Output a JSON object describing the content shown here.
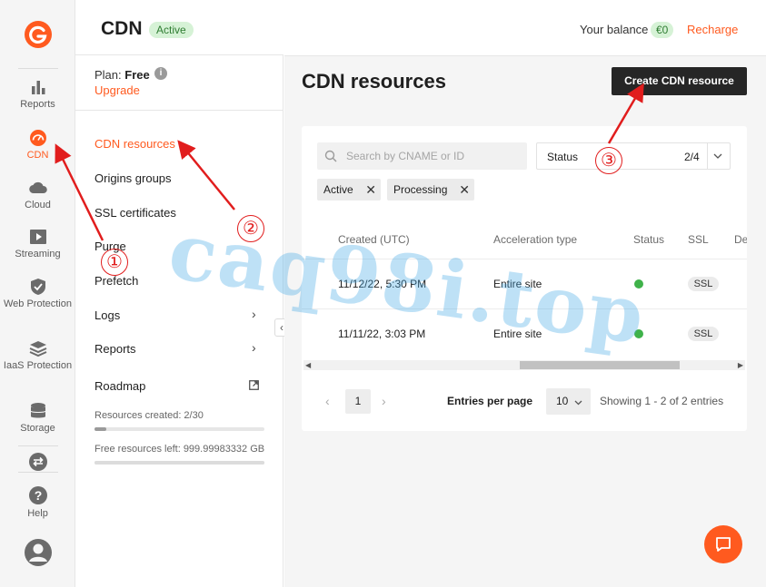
{
  "header": {
    "title": "CDN",
    "status_badge": "Active",
    "balance_label": "Your balance",
    "balance_value": "€0",
    "recharge_label": "Recharge"
  },
  "rail": {
    "items": [
      {
        "label": "Reports",
        "icon": "bar-chart-icon"
      },
      {
        "label": "CDN",
        "icon": "speedometer-icon",
        "active": true
      },
      {
        "label": "Cloud",
        "icon": "cloud-icon"
      },
      {
        "label": "Streaming",
        "icon": "play-icon"
      },
      {
        "label": "Web Protection",
        "icon": "shield-check-icon"
      },
      {
        "label": "IaaS Protection",
        "icon": "stack-icon"
      },
      {
        "label": "Storage",
        "icon": "database-icon"
      },
      {
        "label": "",
        "icon": "swap-arrows-icon"
      },
      {
        "label": "Help",
        "icon": "question-icon"
      },
      {
        "label": "",
        "icon": "user-avatar-icon"
      }
    ],
    "accent_color": "#ff5a1f"
  },
  "subnav": {
    "plan_label": "Plan:",
    "plan_value": "Free",
    "upgrade_label": "Upgrade",
    "links": [
      {
        "label": "CDN resources",
        "active": true
      },
      {
        "label": "Origins groups"
      },
      {
        "label": "SSL certificates"
      },
      {
        "label": "Purge"
      },
      {
        "label": "Prefetch"
      },
      {
        "label": "Logs",
        "has_submenu": true
      },
      {
        "label": "Reports",
        "has_submenu": true
      },
      {
        "label": "Roadmap",
        "external": true
      }
    ],
    "resources_created": "Resources created: 2/30",
    "resources_created_fraction": 0.067,
    "free_resources": "Free resources left: 999.99983332 GB",
    "free_resources_fraction": 1.0
  },
  "main": {
    "title": "CDN resources",
    "create_button": "Create CDN resource",
    "search_placeholder": "Search by CNAME or ID",
    "status_filter_label": "Status",
    "status_filter_count": "2/4",
    "chips": [
      "Active",
      "Processing"
    ],
    "columns": [
      "Created (UTC)",
      "Acceleration type",
      "Status",
      "SSL",
      "De"
    ],
    "rows": [
      {
        "created": "11/12/22, 5:30 PM",
        "acceleration": "Entire site",
        "status": "active",
        "ssl": "SSL"
      },
      {
        "created": "11/11/22, 3:03 PM",
        "acceleration": "Entire site",
        "status": "active",
        "ssl": "SSL"
      }
    ],
    "status_active_color": "#3fb24a",
    "pagination": {
      "current_page": "1",
      "entries_label": "Entries per page",
      "entries_value": "10",
      "showing": "Showing 1 - 2 of 2 entries"
    }
  },
  "annotations": {
    "markers": [
      "①",
      "②",
      "③"
    ],
    "watermark": "caq98i.top",
    "color": "#e11d1d"
  }
}
